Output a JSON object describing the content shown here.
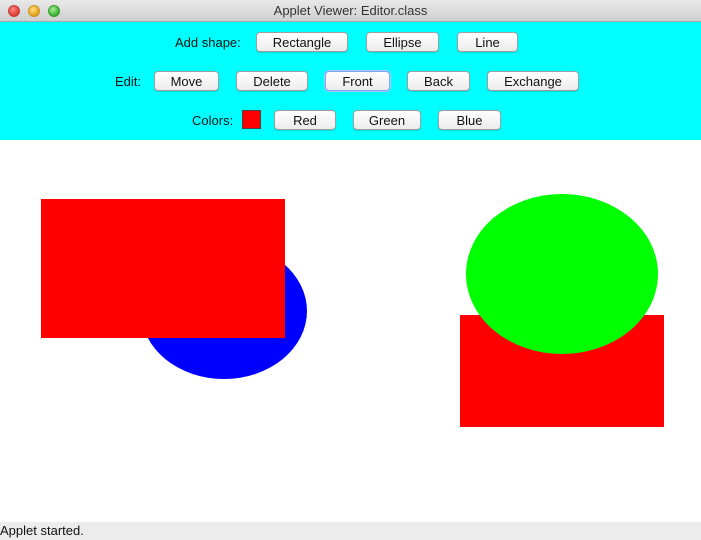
{
  "window": {
    "title": "Applet Viewer: Editor.class"
  },
  "toolbar": {
    "add_shape_label": "Add shape:",
    "add_buttons": [
      "Rectangle",
      "Ellipse",
      "Line"
    ],
    "edit_label": "Edit:",
    "edit_buttons": [
      "Move",
      "Delete",
      "Front",
      "Back",
      "Exchange"
    ],
    "focused_button": "Front",
    "colors_label": "Colors:",
    "current_color": "#ff0000",
    "color_buttons": [
      "Red",
      "Green",
      "Blue"
    ]
  },
  "canvas": {
    "background": "#ffffff",
    "shapes": [
      {
        "type": "ellipse",
        "color": "#0000ff"
      },
      {
        "type": "rectangle",
        "color": "#ff0000"
      },
      {
        "type": "rectangle",
        "color": "#ff0000"
      },
      {
        "type": "ellipse",
        "color": "#00ff00"
      }
    ]
  },
  "status": {
    "text": "Applet started."
  },
  "colors": {
    "toolbar_bg": "#00ffff",
    "red": "#ff0000",
    "green": "#00ff00",
    "blue": "#0000ff"
  }
}
